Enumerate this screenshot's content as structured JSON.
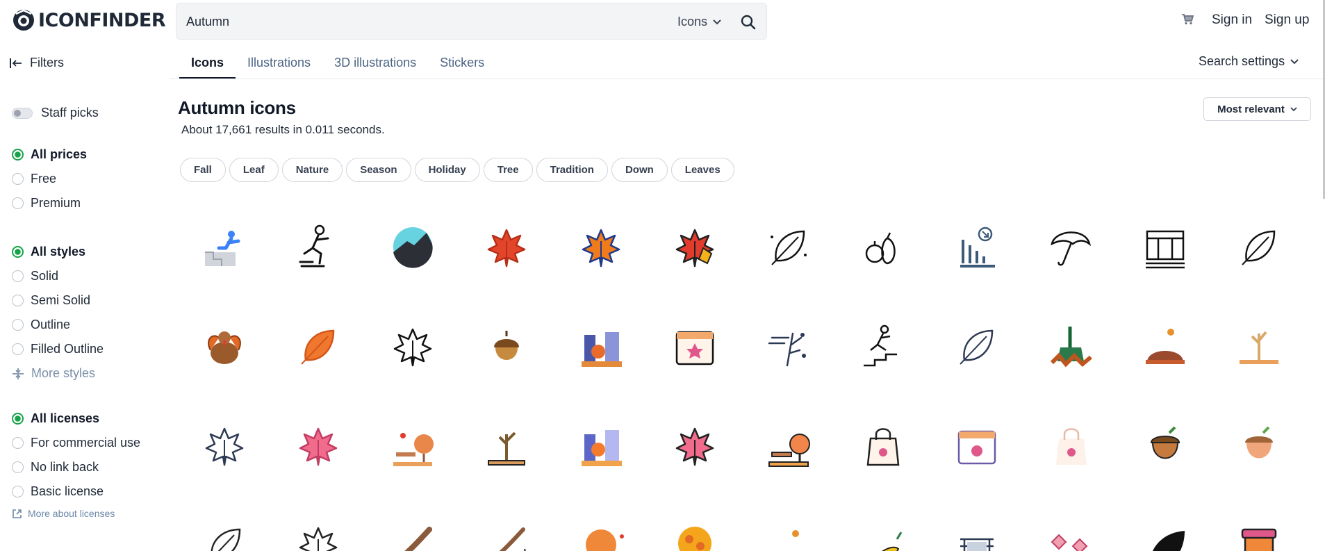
{
  "header": {
    "logo_text": "ICONFINDER",
    "search_value": "Autumn",
    "search_type": "Icons",
    "sign_in": "Sign in",
    "sign_up": "Sign up"
  },
  "nav": {
    "filters_label": "Filters",
    "tabs": [
      {
        "label": "Icons",
        "active": true
      },
      {
        "label": "Illustrations",
        "active": false
      },
      {
        "label": "3D illustrations",
        "active": false
      },
      {
        "label": "Stickers",
        "active": false
      }
    ],
    "search_settings": "Search settings"
  },
  "sidebar": {
    "staff_picks": "Staff picks",
    "prices": [
      {
        "label": "All prices",
        "selected": true
      },
      {
        "label": "Free",
        "selected": false
      },
      {
        "label": "Premium",
        "selected": false
      }
    ],
    "styles": [
      {
        "label": "All styles",
        "selected": true
      },
      {
        "label": "Solid",
        "selected": false
      },
      {
        "label": "Semi Solid",
        "selected": false
      },
      {
        "label": "Outline",
        "selected": false
      },
      {
        "label": "Filled Outline",
        "selected": false
      }
    ],
    "more_styles": "More styles",
    "licenses": [
      {
        "label": "All licenses",
        "selected": true
      },
      {
        "label": "For commercial use",
        "selected": false
      },
      {
        "label": "No link back",
        "selected": false
      },
      {
        "label": "Basic license",
        "selected": false
      }
    ],
    "more_licenses": "More about licenses"
  },
  "main": {
    "heading": "Autumn icons",
    "results_text": "About 17,661 results in 0.011 seconds.",
    "sort_label": "Most relevant",
    "tags": [
      "Fall",
      "Leaf",
      "Nature",
      "Season",
      "Holiday",
      "Tree",
      "Tradition",
      "Down",
      "Leaves"
    ],
    "icons": [
      "falling-stairs-icon",
      "slip-fall-icon",
      "hill-night-icon",
      "red-maple-leaf-icon",
      "orange-maple-leaf-icon",
      "autumn-leaves-icon",
      "oak-leaf-outline-icon",
      "fruits-outline-icon",
      "decline-chart-icon",
      "umbrella-rain-icon",
      "waterfall-trees-icon",
      "leaf-outline-icon",
      "turkey-icon",
      "orange-leaf-icon",
      "maple-leaf-outline-icon",
      "acorn-icon",
      "autumn-city-icon",
      "autumn-calendar-icon",
      "windy-tree-icon",
      "stairs-slip-icon",
      "leaf-line-icon",
      "leaf-rake-icon",
      "leaf-pile-icon",
      "bare-tree-icon",
      "maple-leaf-line-icon",
      "pink-maple-leaf-icon",
      "park-bench-icon",
      "bare-tree-ground-icon",
      "city-autumn-icon",
      "pink-leaf-icon",
      "park-tree-icon",
      "shopping-bag-icon",
      "calendar-leaf-icon",
      "bag-leaf-icon",
      "acorn-brown-icon",
      "acorn-light-icon",
      "leaf-outline-icon",
      "maple-outline-icon",
      "branch-icon",
      "branch-sparkle-icon",
      "orange-tree-icon",
      "autumn-tree-icon",
      "leaf-pile-icon",
      "bird-icon",
      "bridge-icon",
      "pink-leaves-icon",
      "black-leaf-icon",
      "jam-jar-icon"
    ]
  },
  "colors": {
    "accent_green": "#16a34a",
    "link_blue": "#4b6584",
    "text_dark": "#111827"
  }
}
